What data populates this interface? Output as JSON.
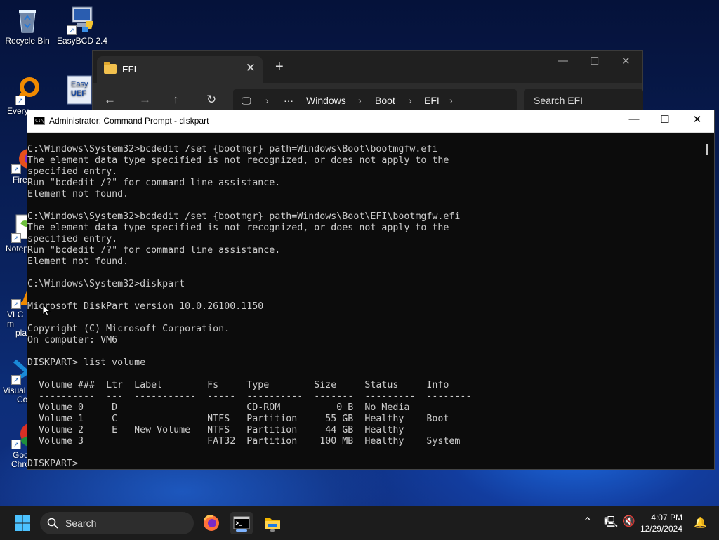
{
  "desktop": {
    "icons": [
      {
        "label": "Recycle Bin"
      },
      {
        "label": "EasyBCD 2.4"
      },
      {
        "label": "Every"
      },
      {
        "label": "Easy UEFI"
      },
      {
        "label": "Fire"
      },
      {
        "label": "Notep"
      },
      {
        "label": "VLC m"
      },
      {
        "label": "pla"
      },
      {
        "label": "Visual"
      },
      {
        "label": "Co"
      },
      {
        "label": "Goo"
      },
      {
        "label": "Chrome"
      }
    ]
  },
  "explorer": {
    "tab_title": "EFI",
    "tab_close": "✕",
    "new_tab": "+",
    "breadcrumb": [
      "Windows",
      "Boot",
      "EFI"
    ],
    "ellipsis": "···",
    "search_placeholder": "Search EFI"
  },
  "cmd": {
    "title": "Administrator: Command Prompt - diskpart",
    "icon_text": "C:\\",
    "lines": [
      "C:\\Windows\\System32>bcdedit /set {bootmgr} path=Windows\\Boot\\bootmgfw.efi",
      "The element data type specified is not recognized, or does not apply to the",
      "specified entry.",
      "Run \"bcdedit /?\" for command line assistance.",
      "Element not found.",
      "",
      "C:\\Windows\\System32>bcdedit /set {bootmgr} path=Windows\\Boot\\EFI\\bootmgfw.efi",
      "The element data type specified is not recognized, or does not apply to the",
      "specified entry.",
      "Run \"bcdedit /?\" for command line assistance.",
      "Element not found.",
      "",
      "C:\\Windows\\System32>diskpart",
      "",
      "Microsoft DiskPart version 10.0.26100.1150",
      "",
      "Copyright (C) Microsoft Corporation.",
      "On computer: VM6",
      "",
      "DISKPART> list volume",
      "",
      "  Volume ###  Ltr  Label        Fs     Type        Size     Status     Info",
      "  ----------  ---  -----------  -----  ----------  -------  ---------  --------",
      "  Volume 0     D                       CD-ROM          0 B  No Media",
      "  Volume 1     C                NTFS   Partition     55 GB  Healthy    Boot",
      "  Volume 2     E   New Volume   NTFS   Partition     44 GB  Healthy",
      "  Volume 3                      FAT32  Partition    100 MB  Healthy    System",
      "",
      "DISKPART>"
    ]
  },
  "taskbar": {
    "search_label": "Search",
    "time": "4:07 PM",
    "date": "12/29/2024"
  }
}
